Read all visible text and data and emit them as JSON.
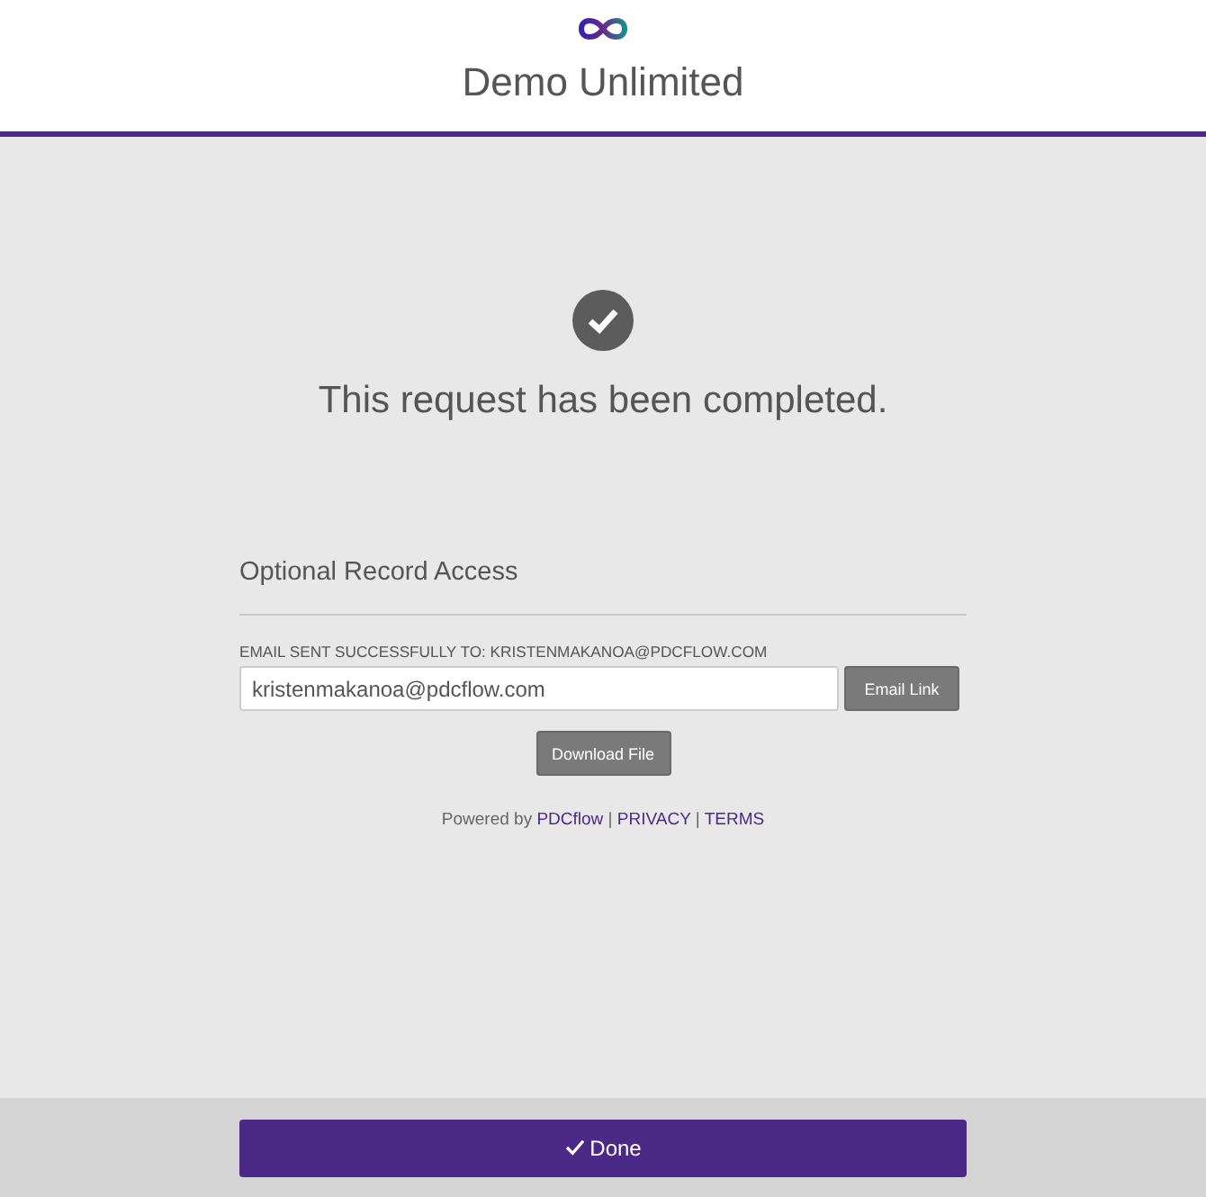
{
  "header": {
    "title": "Demo Unlimited"
  },
  "status": {
    "message": "This request has been completed."
  },
  "record_access": {
    "heading": "Optional Record Access",
    "email_label": "EMAIL SENT SUCCESSFULLY TO: KRISTENMAKANOA@PDCFLOW.COM",
    "email_value": "kristenmakanoa@pdcflow.com",
    "email_button": "Email Link",
    "download_button": "Download File"
  },
  "footer_links": {
    "prefix": "Powered by",
    "links": [
      "PDCflow",
      "PRIVACY",
      "TERMS"
    ],
    "separator": "|"
  },
  "done_button": "Done"
}
